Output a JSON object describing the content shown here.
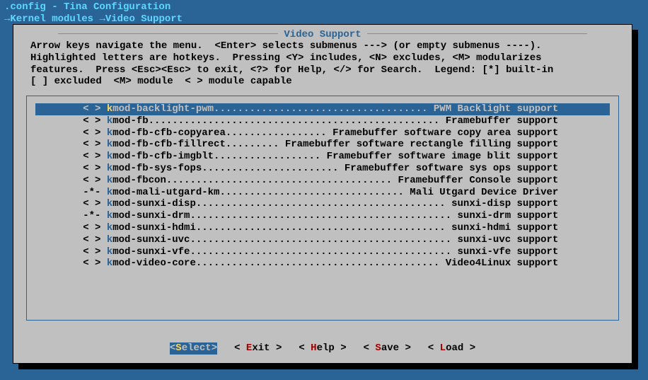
{
  "title": ".config - Tina Configuration",
  "breadcrumb": {
    "arrow": "→",
    "parts": [
      "Kernel modules",
      "Video Support"
    ]
  },
  "dialog": {
    "title": "Video Support",
    "instructions": "Arrow keys navigate the menu.  <Enter> selects submenus ---> (or empty submenus ----).\nHighlighted letters are hotkeys.  Pressing <Y> includes, <N> excludes, <M> modularizes\nfeatures.  Press <Esc><Esc> to exit, <?> for Help, </> for Search.  Legend: [*] built-in\n[ ] excluded  <M> module  < > module capable"
  },
  "items": [
    {
      "marker": "< >",
      "hot": "k",
      "name": "mod-backlight-pwm",
      "desc": "PWM Backlight support",
      "selected": true
    },
    {
      "marker": "< >",
      "hot": "k",
      "name": "mod-fb",
      "desc": "Framebuffer support",
      "selected": false
    },
    {
      "marker": "< >",
      "hot": "k",
      "name": "mod-fb-cfb-copyarea",
      "desc": "Framebuffer software copy area support",
      "selected": false
    },
    {
      "marker": "< >",
      "hot": "k",
      "name": "mod-fb-cfb-fillrect",
      "desc": "Framebuffer software rectangle filling support",
      "selected": false
    },
    {
      "marker": "< >",
      "hot": "k",
      "name": "mod-fb-cfb-imgblt",
      "desc": "Framebuffer software image blit support",
      "selected": false
    },
    {
      "marker": "< >",
      "hot": "k",
      "name": "mod-fb-sys-fops",
      "desc": "Framebuffer software sys ops support",
      "selected": false
    },
    {
      "marker": "< >",
      "hot": "k",
      "name": "mod-fbcon",
      "desc": "Framebuffer Console support",
      "selected": false
    },
    {
      "marker": "-*-",
      "hot": "k",
      "name": "mod-mali-utgard-km",
      "desc": "Mali Utgard Device Driver",
      "selected": false
    },
    {
      "marker": "< >",
      "hot": "k",
      "name": "mod-sunxi-disp",
      "desc": "sunxi-disp support",
      "selected": false
    },
    {
      "marker": "-*-",
      "hot": "k",
      "name": "mod-sunxi-drm",
      "desc": "sunxi-drm support",
      "selected": false
    },
    {
      "marker": "< >",
      "hot": "k",
      "name": "mod-sunxi-hdmi",
      "desc": "sunxi-hdmi support",
      "selected": false
    },
    {
      "marker": "< >",
      "hot": "k",
      "name": "mod-sunxi-uvc",
      "desc": "sunxi-uvc support",
      "selected": false
    },
    {
      "marker": "< >",
      "hot": "k",
      "name": "mod-sunxi-vfe",
      "desc": "sunxi-vfe support",
      "selected": false
    },
    {
      "marker": "< >",
      "hot": "k",
      "name": "mod-video-core",
      "desc": "Video4Linux support",
      "selected": false
    }
  ],
  "row_indent": "        ",
  "line_width": 80,
  "buttons": [
    {
      "label": "Select",
      "hot": "S",
      "selected": true
    },
    {
      "label": "Exit",
      "hot": "E",
      "selected": false
    },
    {
      "label": "Help",
      "hot": "H",
      "selected": false
    },
    {
      "label": "Save",
      "hot": "S",
      "selected": false
    },
    {
      "label": "Load",
      "hot": "L",
      "selected": false
    }
  ]
}
